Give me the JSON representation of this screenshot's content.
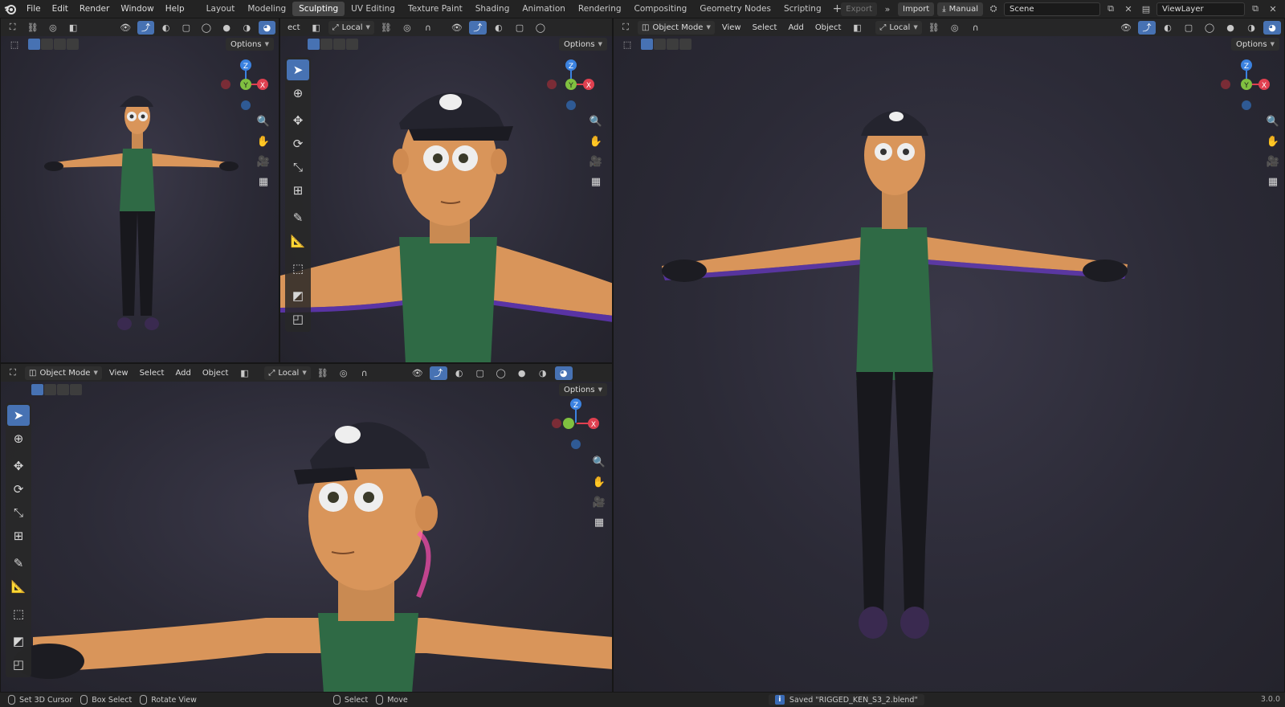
{
  "menu": [
    "File",
    "Edit",
    "Render",
    "Window",
    "Help"
  ],
  "workspaces": [
    {
      "label": "Layout",
      "active": false
    },
    {
      "label": "Modeling",
      "active": false
    },
    {
      "label": "Sculpting",
      "active": true
    },
    {
      "label": "UV Editing",
      "active": false
    },
    {
      "label": "Texture Paint",
      "active": false
    },
    {
      "label": "Shading",
      "active": false
    },
    {
      "label": "Animation",
      "active": false
    },
    {
      "label": "Rendering",
      "active": false
    },
    {
      "label": "Compositing",
      "active": false
    },
    {
      "label": "Geometry Nodes",
      "active": false
    },
    {
      "label": "Scripting",
      "active": false
    }
  ],
  "add_workspace": "+",
  "topright": {
    "export": "Export",
    "import": "Import",
    "manual": "Manual",
    "scene": "Scene",
    "view_layer": "ViewLayer"
  },
  "viewport_header": {
    "mode": "Object Mode",
    "view": "View",
    "select": "Select",
    "add": "Add",
    "object": "Object",
    "orientation": "Local",
    "options": "Options",
    "cut_label": "ect"
  },
  "gizmo": {
    "z": "Z",
    "y": "Y",
    "x": "X",
    "colors": {
      "x": "#e04050",
      "y": "#80c040",
      "z": "#3b82e0"
    }
  },
  "status": {
    "left": [
      {
        "label": "Set 3D Cursor"
      },
      {
        "label": "Box Select"
      },
      {
        "label": "Rotate View"
      },
      {
        "label": "Select"
      },
      {
        "label": "Move"
      }
    ],
    "message": "Saved \"RIGGED_KEN_S3_2.blend\"",
    "version": "3.0.0"
  },
  "colors": {
    "accent": "#4772b3",
    "shirt": "#2f6a45",
    "skin": "#d9955a",
    "cap": "#24242e",
    "pants": "#18181d"
  }
}
